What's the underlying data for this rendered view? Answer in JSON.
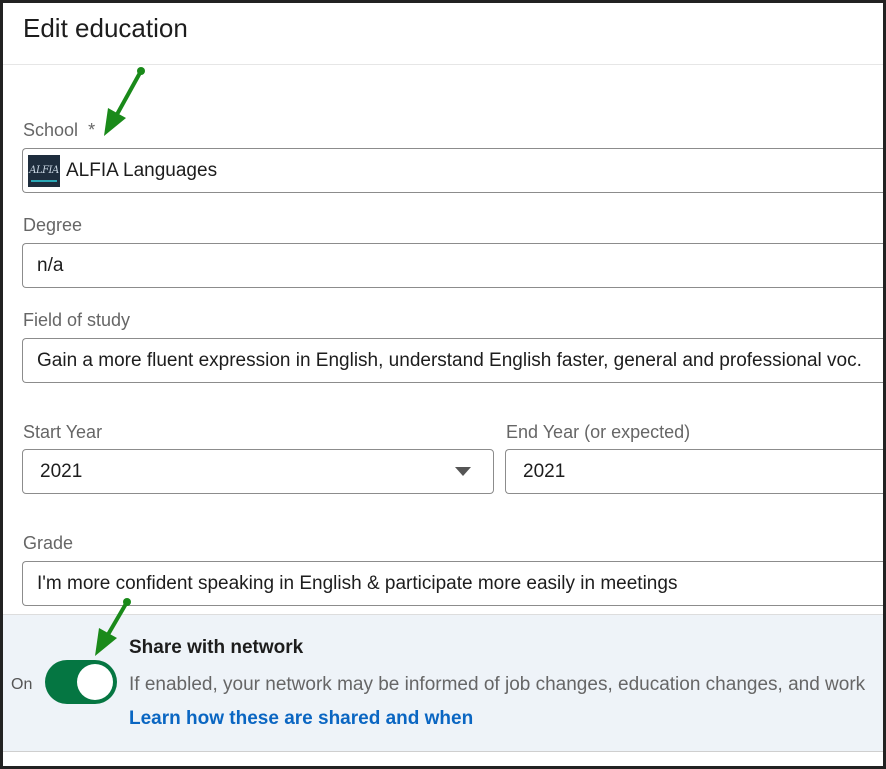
{
  "header": {
    "title": "Edit education"
  },
  "school": {
    "label": "School",
    "required_mark": "*",
    "value": "ALFIA Languages",
    "logo_text": "ALFIA"
  },
  "degree": {
    "label": "Degree",
    "value": "n/a"
  },
  "field_of_study": {
    "label": "Field of study",
    "value": "Gain a more fluent expression in English, understand English faster, general and professional voc."
  },
  "start_year": {
    "label": "Start Year",
    "value": "2021"
  },
  "end_year": {
    "label": "End Year (or expected)",
    "value": "2021"
  },
  "grade": {
    "label": "Grade",
    "value": "I'm more confident speaking in English & participate more easily in meetings"
  },
  "share": {
    "toggle_label": "On",
    "title": "Share with network",
    "description": "If enabled, your network may be informed of job changes, education changes, and work",
    "link": "Learn how these are shared and when"
  },
  "colors": {
    "toggle_on": "#057642",
    "link": "#0a66c2",
    "annotation_arrow": "#1a8a1a",
    "share_background": "#eef3f8"
  },
  "icons": [
    "school-logo-icon",
    "select-chevron-down-icon",
    "annotation-arrow-icon"
  ]
}
